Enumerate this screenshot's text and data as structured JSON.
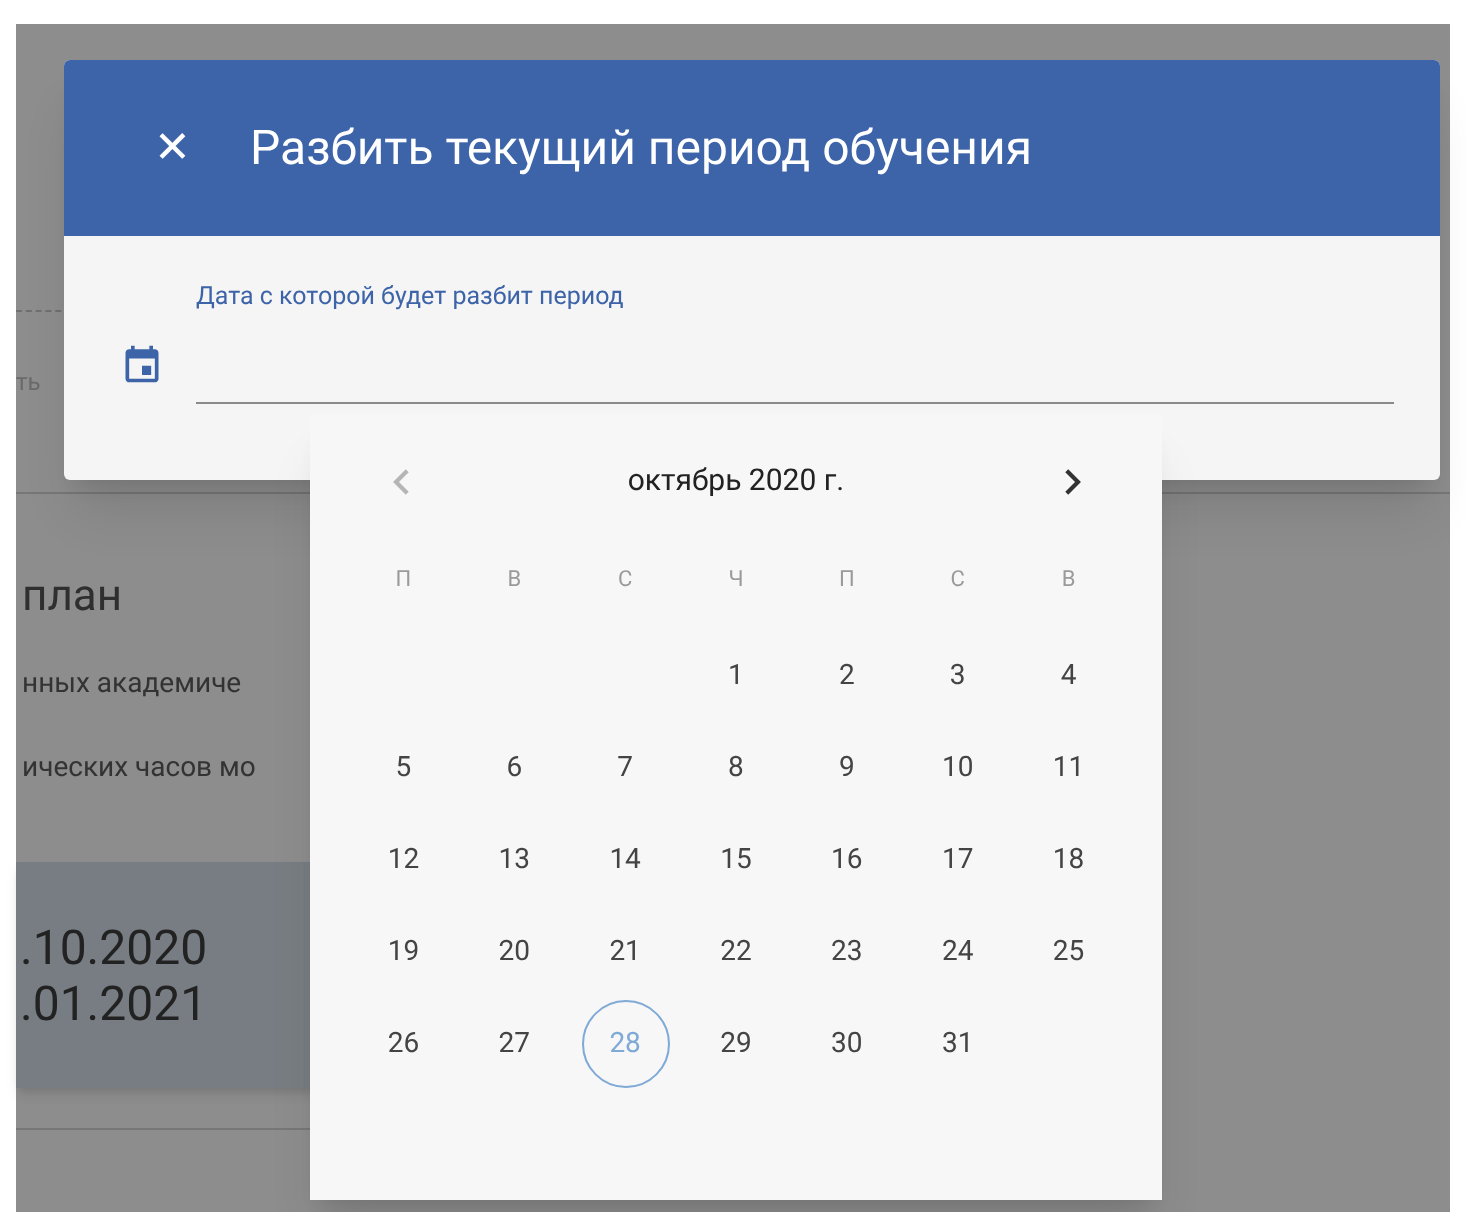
{
  "background_page": {
    "field_label_fragment": "ть",
    "heading": "план",
    "lines": [
      "нных академиче",
      "ических часов мо"
    ],
    "period_card": {
      "dates": [
        ".10.2020",
        ".01.2021"
      ]
    }
  },
  "dialog": {
    "title": "Разбить текущий период обучения",
    "close_label": "✕",
    "date_field": {
      "label": "Дата с которой будет разбит период"
    }
  },
  "datepicker": {
    "month_title": "октябрь 2020 г.",
    "prev": {
      "disabled": true
    },
    "next": {
      "disabled": false
    },
    "weekdays": [
      "П",
      "В",
      "С",
      "Ч",
      "П",
      "С",
      "В"
    ],
    "weeks": [
      [
        {
          "label": "1",
          "today": false
        },
        {
          "label": "2",
          "today": false
        },
        {
          "label": "3",
          "today": false
        },
        {
          "label": "4",
          "today": false
        }
      ],
      [
        {
          "label": "5",
          "today": false
        },
        {
          "label": "6",
          "today": false
        },
        {
          "label": "7",
          "today": false
        },
        {
          "label": "8",
          "today": false
        },
        {
          "label": "9",
          "today": false
        },
        {
          "label": "10",
          "today": false
        },
        {
          "label": "11",
          "today": false
        }
      ],
      [
        {
          "label": "12",
          "today": false
        },
        {
          "label": "13",
          "today": false
        },
        {
          "label": "14",
          "today": false
        },
        {
          "label": "15",
          "today": false
        },
        {
          "label": "16",
          "today": false
        },
        {
          "label": "17",
          "today": false
        },
        {
          "label": "18",
          "today": false
        }
      ],
      [
        {
          "label": "19",
          "today": false
        },
        {
          "label": "20",
          "today": false
        },
        {
          "label": "21",
          "today": false
        },
        {
          "label": "22",
          "today": false
        },
        {
          "label": "23",
          "today": false
        },
        {
          "label": "24",
          "today": false
        },
        {
          "label": "25",
          "today": false
        }
      ],
      [
        {
          "label": "26",
          "today": false
        },
        {
          "label": "27",
          "today": false
        },
        {
          "label": "28",
          "today": true
        },
        {
          "label": "29",
          "today": false
        },
        {
          "label": "30",
          "today": false
        },
        {
          "label": "31",
          "today": false
        }
      ]
    ]
  }
}
